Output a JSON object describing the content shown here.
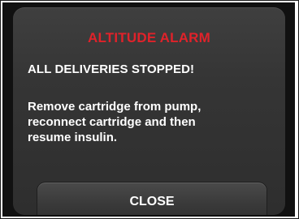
{
  "alarm": {
    "title": "ALTITUDE ALARM",
    "headline": "ALL DELIVERIES STOPPED!",
    "body_lines": [
      "Remove cartridge from pump,",
      "reconnect cartridge and then",
      "resume insulin."
    ],
    "close_label": "CLOSE"
  },
  "colors": {
    "alarm_title": "#e0222a",
    "background": "#111111",
    "dialog": "#383838",
    "text": "#ffffff"
  }
}
